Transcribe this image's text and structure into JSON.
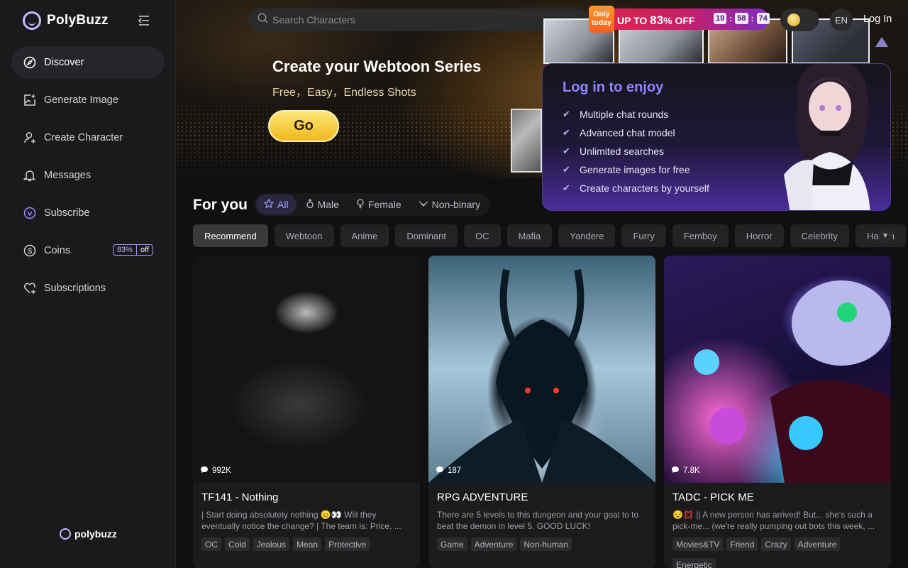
{
  "brand": {
    "name": "PolyBuzz",
    "footer_name": "polybuzz"
  },
  "sidebar": {
    "items": [
      {
        "label": "Discover",
        "icon": "compass-icon"
      },
      {
        "label": "Generate Image",
        "icon": "image-plus-icon"
      },
      {
        "label": "Create Character",
        "icon": "user-plus-icon"
      },
      {
        "label": "Messages",
        "icon": "bell-icon"
      },
      {
        "label": "Subscribe",
        "icon": "vip-icon"
      },
      {
        "label": "Coins",
        "icon": "dollar-icon"
      },
      {
        "label": "Subscriptions",
        "icon": "heart-plus-icon"
      }
    ],
    "coin_badge": {
      "percent": "83%",
      "suffix": "off"
    }
  },
  "search": {
    "placeholder": "Search Characters"
  },
  "promo": {
    "tag": "Only today",
    "text_prefix": "UP TO",
    "percent": "83",
    "percent_sign": "%",
    "text_suffix": "OFF",
    "timer": [
      "19",
      "58",
      "74"
    ]
  },
  "header": {
    "lang": "EN",
    "login": "Log In"
  },
  "hero": {
    "title": "Create your Webtoon Series",
    "subtitle": "Free，Easy，Endless Shots",
    "cta": "Go"
  },
  "login_card": {
    "title": "Log in to enjoy",
    "perks": [
      "Multiple chat rounds",
      "Advanced chat model",
      "Unlimited searches",
      "Generate images for free",
      "Create characters by yourself"
    ]
  },
  "feed": {
    "title": "For you",
    "gender_tabs": [
      "All",
      "Male",
      "Female",
      "Non-binary"
    ],
    "categories": [
      "Recommend",
      "Webtoon",
      "Anime",
      "Dominant",
      "OC",
      "Mafia",
      "Yandere",
      "Furry",
      "Femboy",
      "Horror",
      "Celebrity",
      "Harem"
    ]
  },
  "cards": [
    {
      "count": "992K",
      "title": "TF141 - Nothing",
      "desc": "| Start doing absolutely nothing 😑👀 Will they eventually notice the change? | The team is: Price, ...",
      "tags": [
        "OC",
        "Cold",
        "Jealous",
        "Mean",
        "Protective"
      ]
    },
    {
      "count": "187",
      "title": "RPG ADVENTURE",
      "desc": "There are 5 levels to this dungeon and your goal to to beat the demon in level 5. GOOD LUCK!",
      "tags": [
        "Game",
        "Adventure",
        "Non-human"
      ]
    },
    {
      "count": "7.8K",
      "title": "TADC - PICK ME",
      "desc": "😒💢 || A new person has arrived! But... she's such a pick-me... (we're really pumping out bots this week, ...",
      "tags": [
        "Movies&TV",
        "Friend",
        "Crazy",
        "Adventure",
        "Energetic"
      ]
    }
  ]
}
